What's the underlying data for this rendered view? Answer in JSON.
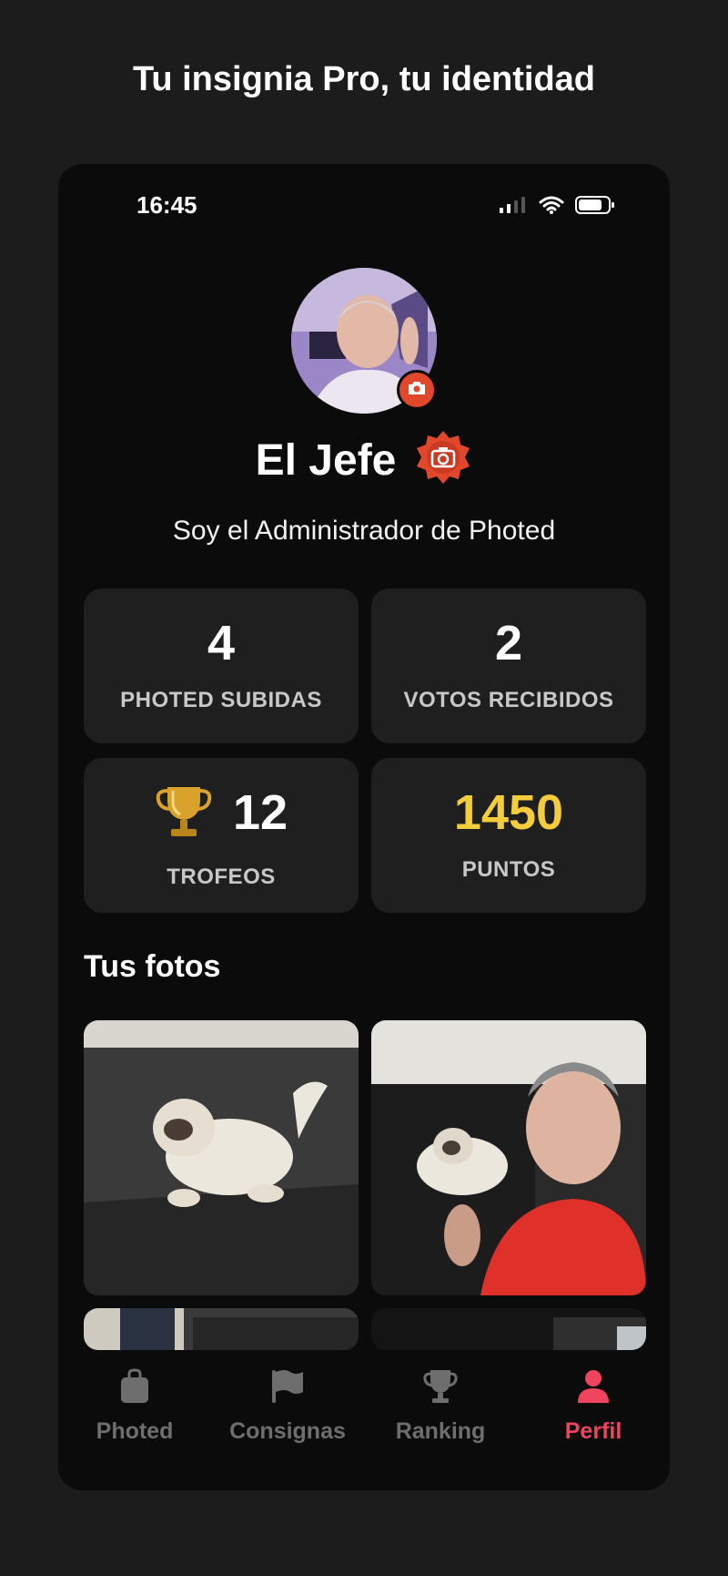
{
  "headline": "Tu insignia Pro, tu identidad",
  "status_bar": {
    "time": "16:45"
  },
  "profile": {
    "name": "El Jefe",
    "bio": "Soy el Administrador de Photed"
  },
  "stats": {
    "uploaded": {
      "value": "4",
      "label": "PHOTED SUBIDAS"
    },
    "votes": {
      "value": "2",
      "label": "VOTOS RECIBIDOS"
    },
    "trophies": {
      "value": "12",
      "label": "TROFEOS"
    },
    "points": {
      "value": "1450",
      "label": "PUNTOS"
    }
  },
  "photos_section": {
    "title": "Tus fotos"
  },
  "tabs": [
    {
      "label": "Photed",
      "icon": "bag-icon"
    },
    {
      "label": "Consignas",
      "icon": "flag-icon"
    },
    {
      "label": "Ranking",
      "icon": "trophy-icon"
    },
    {
      "label": "Perfil",
      "icon": "person-icon",
      "active": true
    }
  ],
  "colors": {
    "accent": "#f0435e",
    "badge": "#e0472b",
    "points": "#f4cd3d",
    "card": "#1f1f20"
  }
}
